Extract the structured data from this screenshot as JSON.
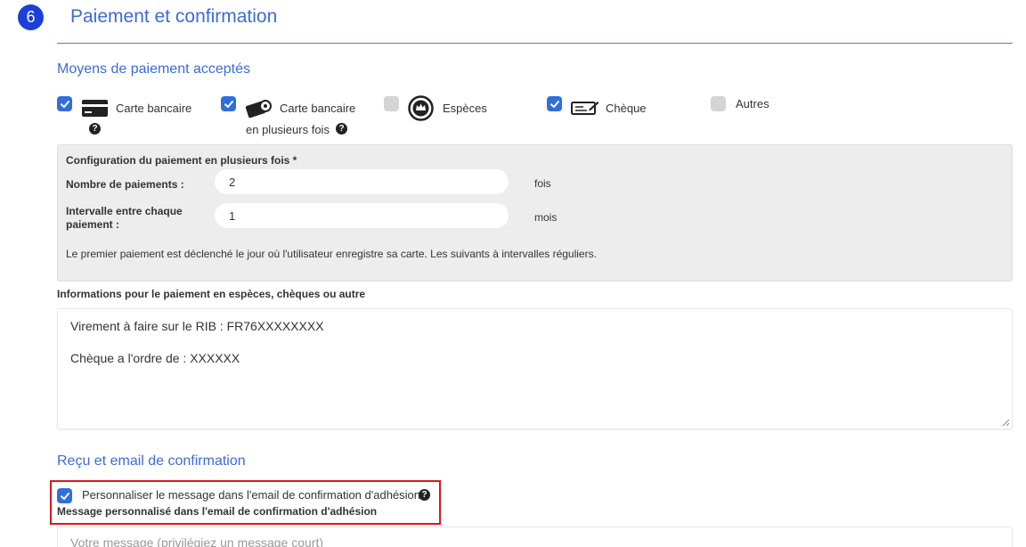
{
  "section": {
    "step_number": "6",
    "title": "Paiement et confirmation"
  },
  "payment_methods": {
    "title": "Moyens de paiement acceptés",
    "items": [
      {
        "label": "Carte bancaire",
        "checked": true,
        "icon": "credit-card-icon",
        "help": true
      },
      {
        "label_line1": "Carte bancaire",
        "label_line2": "en plusieurs fois",
        "checked": true,
        "icon": "card-installments-icon",
        "help": true
      },
      {
        "label": "Espèces",
        "checked": false,
        "icon": "cash-coin-icon",
        "help": false
      },
      {
        "label": "Chèque",
        "checked": true,
        "icon": "cheque-icon",
        "help": false
      },
      {
        "label": "Autres",
        "checked": false,
        "icon": null,
        "help": false
      }
    ]
  },
  "installments": {
    "title": "Configuration du paiement en plusieurs fois *",
    "count_label": "Nombre de paiements :",
    "count_value": "2",
    "count_unit": "fois",
    "interval_label_line1": "Intervalle entre chaque",
    "interval_label_line2": "paiement :",
    "interval_value": "1",
    "interval_unit": "mois",
    "note": "Le premier paiement est déclenché le jour où l'utilisateur enregistre sa carte. Les suivants à intervalles réguliers."
  },
  "other_payment_info": {
    "label": "Informations pour le paiement en espèces, chèques ou autre",
    "line1": "Virement à faire sur le RIB : FR76XXXXXXXX",
    "line2": "Chèque a l'ordre de : XXXXXX"
  },
  "receipt": {
    "title": "Reçu et email de confirmation",
    "customize_label": "Personnaliser le message dans l'email de confirmation d'adhésion",
    "customize_checked": true,
    "message_label": "Message personnalisé dans l'email de confirmation d'adhésion",
    "message_placeholder": "Votre message (privilégiez un message court)"
  },
  "colors": {
    "accent": "#3d6bd6",
    "badge": "#1b3fd8",
    "checkbox_on": "#2f6fdb",
    "highlight": "#e0141e"
  }
}
